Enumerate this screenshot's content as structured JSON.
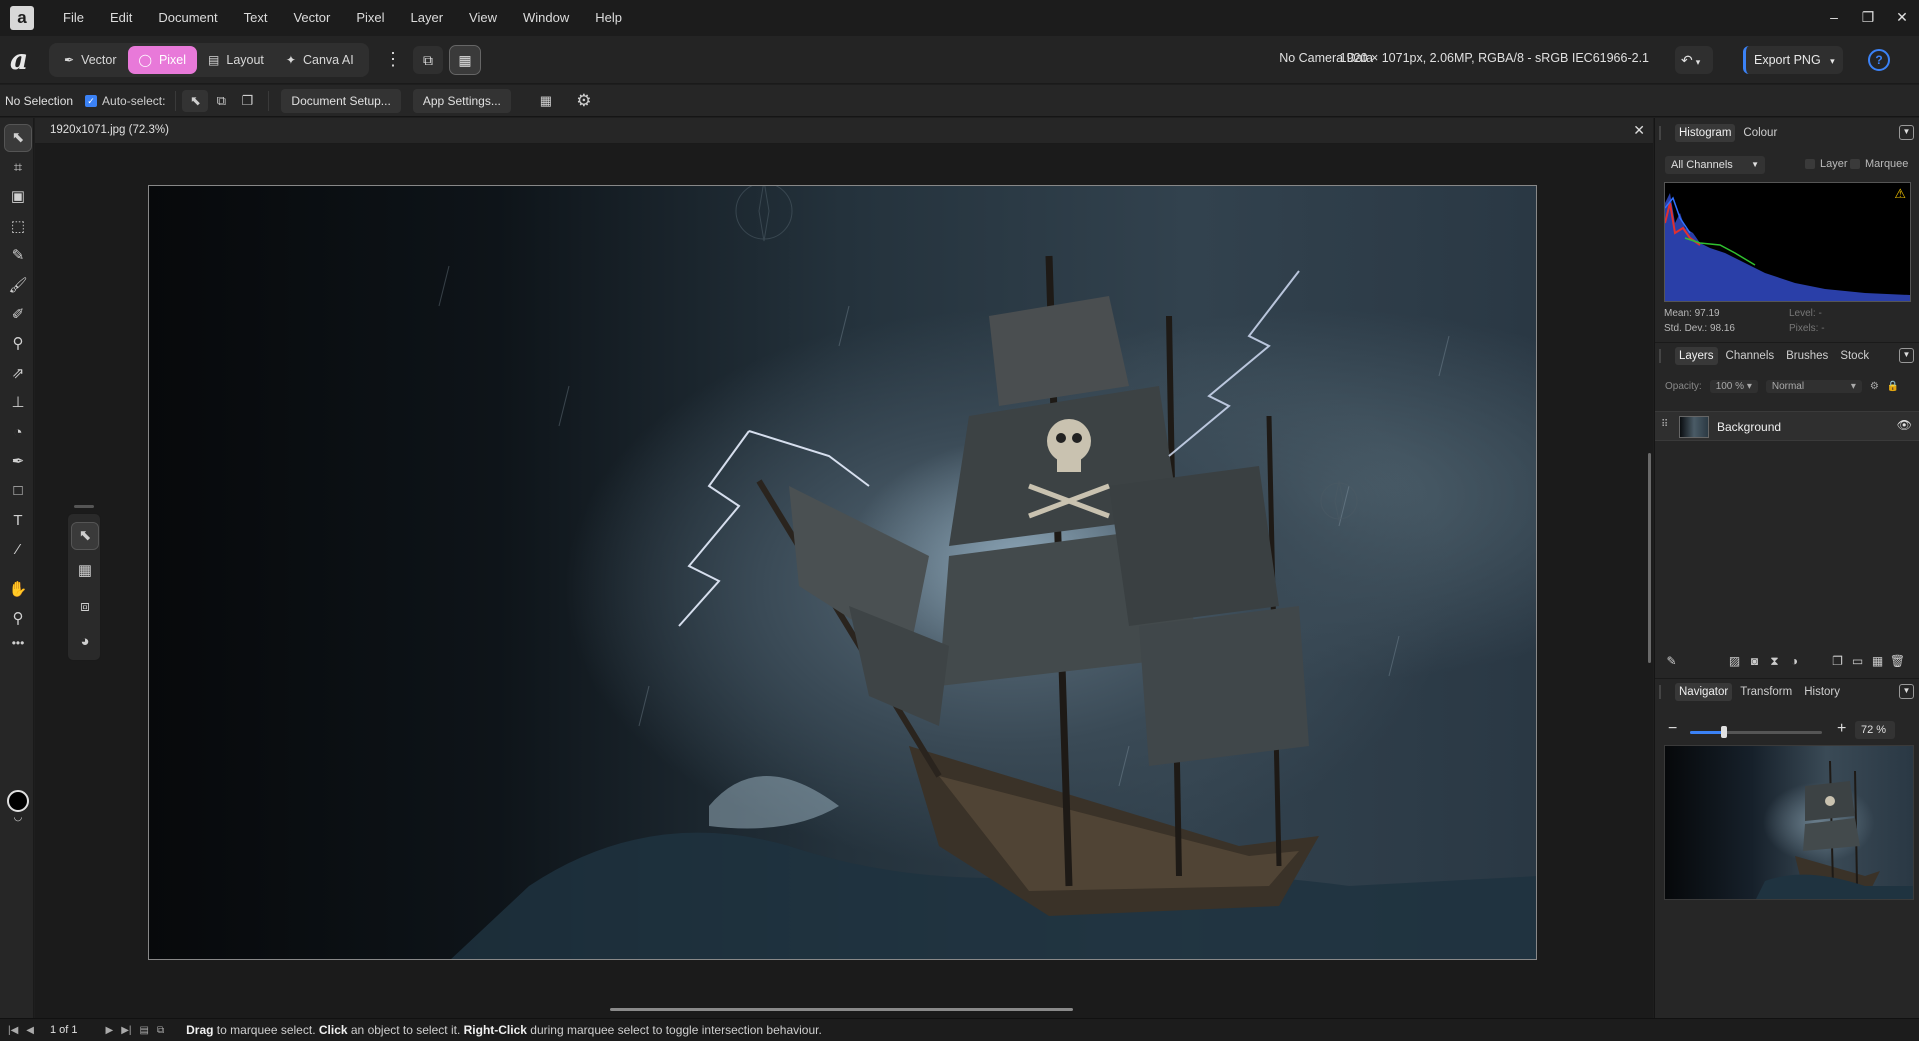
{
  "menubar": {
    "logo": "a",
    "items": [
      "File",
      "Edit",
      "Document",
      "Text",
      "Vector",
      "Pixel",
      "Layer",
      "View",
      "Window",
      "Help"
    ],
    "window_controls": [
      "–",
      "❐",
      "✕"
    ]
  },
  "toolbar": {
    "logo": "a",
    "personas": [
      {
        "label": "Vector",
        "icon": "vector-pen-icon"
      },
      {
        "label": "Pixel",
        "icon": "pixel-brush-icon",
        "active": true
      },
      {
        "label": "Layout",
        "icon": "layout-icon"
      },
      {
        "label": "Canva AI",
        "icon": "sparkle-icon"
      }
    ],
    "camera_data": "No Camera Data",
    "doc_info": "1920 × 1071px, 2.06MP, RGBA/8 - sRGB IEC61966-2.1",
    "export_label": "Export PNG",
    "help_label": "?"
  },
  "context": {
    "selection": "No Selection",
    "auto_select_label": "Auto-select:",
    "auto_select_checked": true,
    "document_setup": "Document Setup...",
    "app_settings": "App Settings..."
  },
  "document": {
    "tab_title": "1920x1071.jpg (72.3%)"
  },
  "histogram_panel": {
    "tabs": [
      "Histogram",
      "Colour"
    ],
    "channel": "All Channels",
    "layer_label": "Layer",
    "marquee_label": "Marquee",
    "mean": "Mean: 97.19",
    "std_dev": "Std. Dev.: 98.16",
    "level": "Level: -",
    "pixels": "Pixels: -",
    "warning_icon": "warning-icon"
  },
  "layers_panel": {
    "tabs": [
      "Layers",
      "Channels",
      "Brushes",
      "Stock"
    ],
    "opacity_label": "Opacity:",
    "opacity_value": "100 %",
    "blend_mode": "Normal",
    "layers": [
      {
        "name": "Background",
        "visible": true
      }
    ]
  },
  "navigator_panel": {
    "tabs": [
      "Navigator",
      "Transform",
      "History"
    ],
    "zoom": "72 %",
    "zoom_fraction": 0.26
  },
  "status": {
    "page": "1 of 1",
    "hint_parts": [
      {
        "b": "Drag",
        "t": " to marquee select. "
      },
      {
        "b": "Click",
        "t": " an object to select it. "
      },
      {
        "b": "Right-Click",
        "t": " during marquee select to toggle intersection behaviour."
      }
    ]
  },
  "colors": {
    "accent": "#3b82f6",
    "persona_active": "#e879d9",
    "panel_bg": "#262626",
    "canvas_bg": "#1b1b1b"
  }
}
